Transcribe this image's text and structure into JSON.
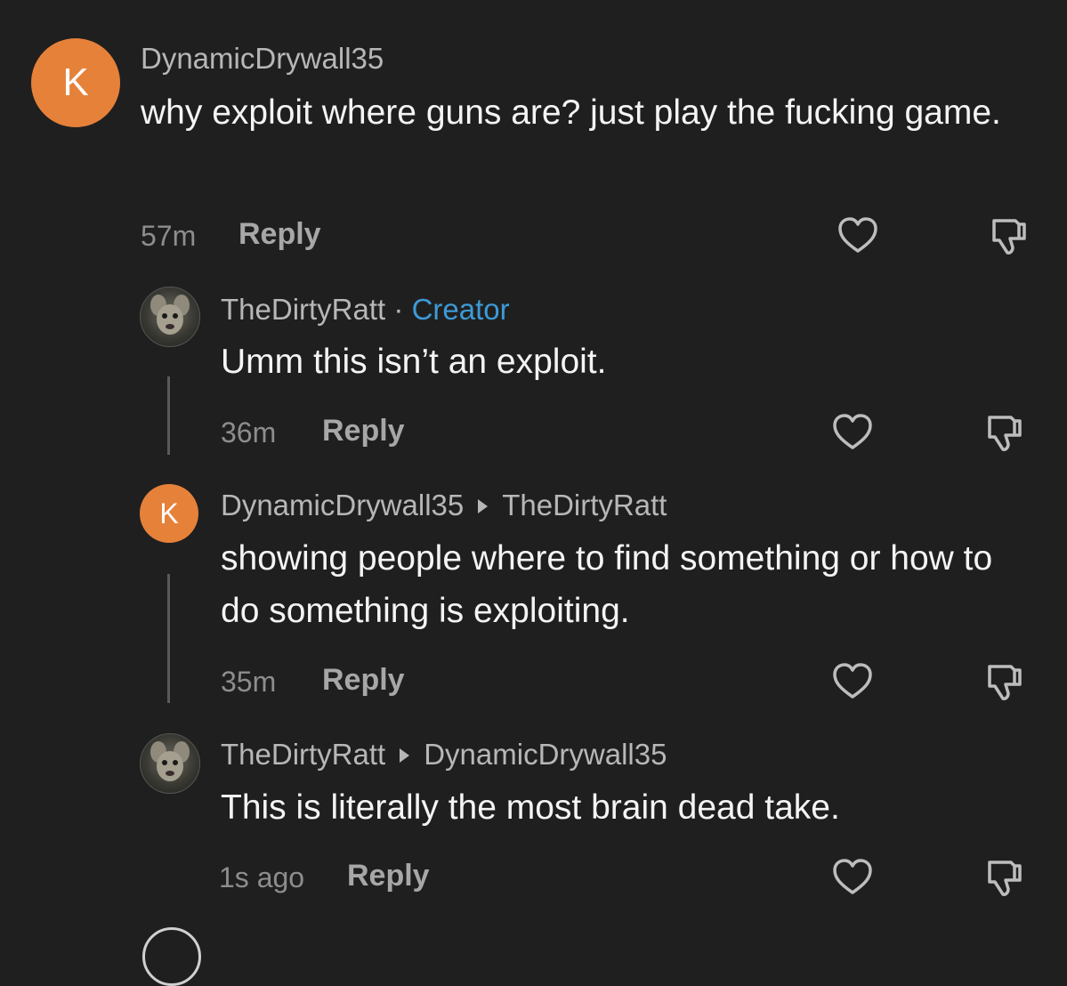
{
  "comments": [
    {
      "avatar_letter": "K",
      "username": "DynamicDrywall35",
      "text": "why exploit where guns are? just play the fucking game.",
      "time": "57m",
      "reply_label": "Reply"
    },
    {
      "username": "TheDirtyRatt",
      "badge_separator": "·",
      "badge": "Creator",
      "text": "Umm this isn’t an exploit.",
      "time": "36m",
      "reply_label": "Reply"
    },
    {
      "avatar_letter": "K",
      "username": "DynamicDrywall35",
      "reply_to": "TheDirtyRatt",
      "text": "showing people where to find something or how to do something is exploiting.",
      "time": "35m",
      "reply_label": "Reply"
    },
    {
      "username": "TheDirtyRatt",
      "reply_to": "DynamicDrywall35",
      "text": "This is literally the most brain dead take.",
      "time": "1s ago",
      "reply_label": "Reply"
    }
  ],
  "colors": {
    "background": "#1f1f1f",
    "avatar_orange": "#e6813a",
    "creator_blue": "#3d9ad6"
  },
  "icons": {
    "like": "heart-icon",
    "dislike": "thumbs-down-icon",
    "reply_arrow": "triangle-right-icon"
  }
}
